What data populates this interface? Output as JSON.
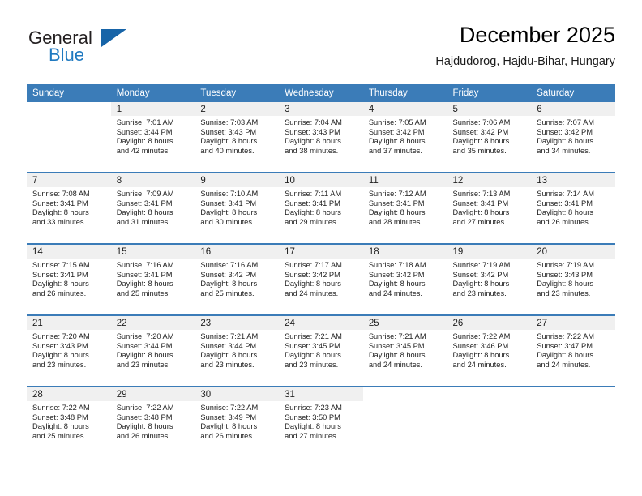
{
  "brand": {
    "name_part1": "General",
    "name_part2": "Blue",
    "triangle_color": "#1764a8",
    "blue_color": "#1f79c0"
  },
  "header": {
    "title": "December 2025",
    "subtitle": "Hajdudorog, Hajdu-Bihar, Hungary"
  },
  "theme": {
    "header_bg": "#3b7cb8",
    "daynum_bg": "#f0f0f0",
    "separator": "#3b7cb8"
  },
  "weekday_headers": [
    "Sunday",
    "Monday",
    "Tuesday",
    "Wednesday",
    "Thursday",
    "Friday",
    "Saturday"
  ],
  "weeks": [
    [
      {
        "day": "",
        "sunrise": "",
        "sunset": "",
        "daylight_line1": "",
        "daylight_line2": ""
      },
      {
        "day": "1",
        "sunrise": "Sunrise: 7:01 AM",
        "sunset": "Sunset: 3:44 PM",
        "daylight_line1": "Daylight: 8 hours",
        "daylight_line2": "and 42 minutes."
      },
      {
        "day": "2",
        "sunrise": "Sunrise: 7:03 AM",
        "sunset": "Sunset: 3:43 PM",
        "daylight_line1": "Daylight: 8 hours",
        "daylight_line2": "and 40 minutes."
      },
      {
        "day": "3",
        "sunrise": "Sunrise: 7:04 AM",
        "sunset": "Sunset: 3:43 PM",
        "daylight_line1": "Daylight: 8 hours",
        "daylight_line2": "and 38 minutes."
      },
      {
        "day": "4",
        "sunrise": "Sunrise: 7:05 AM",
        "sunset": "Sunset: 3:42 PM",
        "daylight_line1": "Daylight: 8 hours",
        "daylight_line2": "and 37 minutes."
      },
      {
        "day": "5",
        "sunrise": "Sunrise: 7:06 AM",
        "sunset": "Sunset: 3:42 PM",
        "daylight_line1": "Daylight: 8 hours",
        "daylight_line2": "and 35 minutes."
      },
      {
        "day": "6",
        "sunrise": "Sunrise: 7:07 AM",
        "sunset": "Sunset: 3:42 PM",
        "daylight_line1": "Daylight: 8 hours",
        "daylight_line2": "and 34 minutes."
      }
    ],
    [
      {
        "day": "7",
        "sunrise": "Sunrise: 7:08 AM",
        "sunset": "Sunset: 3:41 PM",
        "daylight_line1": "Daylight: 8 hours",
        "daylight_line2": "and 33 minutes."
      },
      {
        "day": "8",
        "sunrise": "Sunrise: 7:09 AM",
        "sunset": "Sunset: 3:41 PM",
        "daylight_line1": "Daylight: 8 hours",
        "daylight_line2": "and 31 minutes."
      },
      {
        "day": "9",
        "sunrise": "Sunrise: 7:10 AM",
        "sunset": "Sunset: 3:41 PM",
        "daylight_line1": "Daylight: 8 hours",
        "daylight_line2": "and 30 minutes."
      },
      {
        "day": "10",
        "sunrise": "Sunrise: 7:11 AM",
        "sunset": "Sunset: 3:41 PM",
        "daylight_line1": "Daylight: 8 hours",
        "daylight_line2": "and 29 minutes."
      },
      {
        "day": "11",
        "sunrise": "Sunrise: 7:12 AM",
        "sunset": "Sunset: 3:41 PM",
        "daylight_line1": "Daylight: 8 hours",
        "daylight_line2": "and 28 minutes."
      },
      {
        "day": "12",
        "sunrise": "Sunrise: 7:13 AM",
        "sunset": "Sunset: 3:41 PM",
        "daylight_line1": "Daylight: 8 hours",
        "daylight_line2": "and 27 minutes."
      },
      {
        "day": "13",
        "sunrise": "Sunrise: 7:14 AM",
        "sunset": "Sunset: 3:41 PM",
        "daylight_line1": "Daylight: 8 hours",
        "daylight_line2": "and 26 minutes."
      }
    ],
    [
      {
        "day": "14",
        "sunrise": "Sunrise: 7:15 AM",
        "sunset": "Sunset: 3:41 PM",
        "daylight_line1": "Daylight: 8 hours",
        "daylight_line2": "and 26 minutes."
      },
      {
        "day": "15",
        "sunrise": "Sunrise: 7:16 AM",
        "sunset": "Sunset: 3:41 PM",
        "daylight_line1": "Daylight: 8 hours",
        "daylight_line2": "and 25 minutes."
      },
      {
        "day": "16",
        "sunrise": "Sunrise: 7:16 AM",
        "sunset": "Sunset: 3:42 PM",
        "daylight_line1": "Daylight: 8 hours",
        "daylight_line2": "and 25 minutes."
      },
      {
        "day": "17",
        "sunrise": "Sunrise: 7:17 AM",
        "sunset": "Sunset: 3:42 PM",
        "daylight_line1": "Daylight: 8 hours",
        "daylight_line2": "and 24 minutes."
      },
      {
        "day": "18",
        "sunrise": "Sunrise: 7:18 AM",
        "sunset": "Sunset: 3:42 PM",
        "daylight_line1": "Daylight: 8 hours",
        "daylight_line2": "and 24 minutes."
      },
      {
        "day": "19",
        "sunrise": "Sunrise: 7:19 AM",
        "sunset": "Sunset: 3:42 PM",
        "daylight_line1": "Daylight: 8 hours",
        "daylight_line2": "and 23 minutes."
      },
      {
        "day": "20",
        "sunrise": "Sunrise: 7:19 AM",
        "sunset": "Sunset: 3:43 PM",
        "daylight_line1": "Daylight: 8 hours",
        "daylight_line2": "and 23 minutes."
      }
    ],
    [
      {
        "day": "21",
        "sunrise": "Sunrise: 7:20 AM",
        "sunset": "Sunset: 3:43 PM",
        "daylight_line1": "Daylight: 8 hours",
        "daylight_line2": "and 23 minutes."
      },
      {
        "day": "22",
        "sunrise": "Sunrise: 7:20 AM",
        "sunset": "Sunset: 3:44 PM",
        "daylight_line1": "Daylight: 8 hours",
        "daylight_line2": "and 23 minutes."
      },
      {
        "day": "23",
        "sunrise": "Sunrise: 7:21 AM",
        "sunset": "Sunset: 3:44 PM",
        "daylight_line1": "Daylight: 8 hours",
        "daylight_line2": "and 23 minutes."
      },
      {
        "day": "24",
        "sunrise": "Sunrise: 7:21 AM",
        "sunset": "Sunset: 3:45 PM",
        "daylight_line1": "Daylight: 8 hours",
        "daylight_line2": "and 23 minutes."
      },
      {
        "day": "25",
        "sunrise": "Sunrise: 7:21 AM",
        "sunset": "Sunset: 3:45 PM",
        "daylight_line1": "Daylight: 8 hours",
        "daylight_line2": "and 24 minutes."
      },
      {
        "day": "26",
        "sunrise": "Sunrise: 7:22 AM",
        "sunset": "Sunset: 3:46 PM",
        "daylight_line1": "Daylight: 8 hours",
        "daylight_line2": "and 24 minutes."
      },
      {
        "day": "27",
        "sunrise": "Sunrise: 7:22 AM",
        "sunset": "Sunset: 3:47 PM",
        "daylight_line1": "Daylight: 8 hours",
        "daylight_line2": "and 24 minutes."
      }
    ],
    [
      {
        "day": "28",
        "sunrise": "Sunrise: 7:22 AM",
        "sunset": "Sunset: 3:48 PM",
        "daylight_line1": "Daylight: 8 hours",
        "daylight_line2": "and 25 minutes."
      },
      {
        "day": "29",
        "sunrise": "Sunrise: 7:22 AM",
        "sunset": "Sunset: 3:48 PM",
        "daylight_line1": "Daylight: 8 hours",
        "daylight_line2": "and 26 minutes."
      },
      {
        "day": "30",
        "sunrise": "Sunrise: 7:22 AM",
        "sunset": "Sunset: 3:49 PM",
        "daylight_line1": "Daylight: 8 hours",
        "daylight_line2": "and 26 minutes."
      },
      {
        "day": "31",
        "sunrise": "Sunrise: 7:23 AM",
        "sunset": "Sunset: 3:50 PM",
        "daylight_line1": "Daylight: 8 hours",
        "daylight_line2": "and 27 minutes."
      },
      {
        "day": "",
        "sunrise": "",
        "sunset": "",
        "daylight_line1": "",
        "daylight_line2": ""
      },
      {
        "day": "",
        "sunrise": "",
        "sunset": "",
        "daylight_line1": "",
        "daylight_line2": ""
      },
      {
        "day": "",
        "sunrise": "",
        "sunset": "",
        "daylight_line1": "",
        "daylight_line2": ""
      }
    ]
  ]
}
